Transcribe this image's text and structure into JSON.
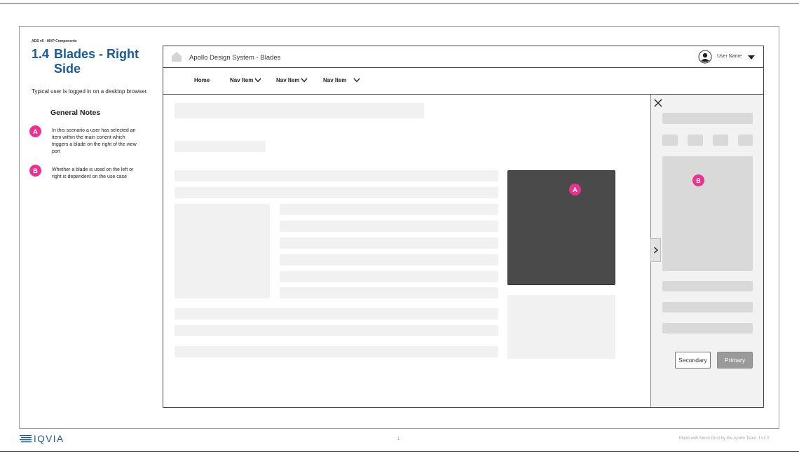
{
  "doc": {
    "label": "ADS v5 - MVP Components",
    "section_number": "1.4",
    "section_title": "Blades - Right Side",
    "intro": "Typical user is logged in on a desktop browser.",
    "notes_heading": "General Notes",
    "notes": [
      {
        "badge": "A",
        "text": "In this scenario a user has selected an item within the main conent which triggers a blade on the right of the view port"
      },
      {
        "badge": "B",
        "text": "Whether a blade is used on the left or right is dependent on the use case"
      }
    ]
  },
  "app": {
    "title": "Apollo Design System - Blades",
    "user_name": "User Name",
    "nav": [
      {
        "label": "Home"
      },
      {
        "label": "Nav Item"
      },
      {
        "label": "Nav Item"
      },
      {
        "label": "Nav Item"
      }
    ],
    "main_badge": "A",
    "blade": {
      "badge": "B",
      "secondary_label": "Secondary",
      "primary_label": "Primary"
    }
  },
  "footer": {
    "logo": "IQVIA",
    "page_number": "1",
    "credit": "Made with Moon Dust by the Apollo Team.  I  v1.0"
  },
  "colors": {
    "heading": "#1b5b94",
    "badge": "#e8338f",
    "placeholder": "#f1f1f1",
    "feature_card": "#4a4a4a",
    "primary_button": "#9a9a9a"
  }
}
